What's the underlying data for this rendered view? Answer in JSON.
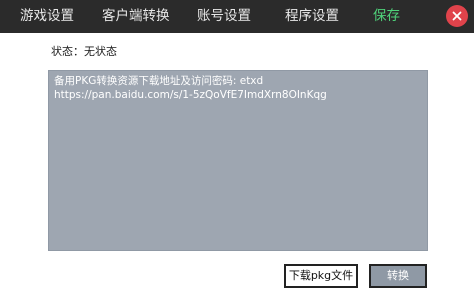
{
  "nav": {
    "tabs": [
      {
        "label": "游戏设置"
      },
      {
        "label": "客户端转换"
      },
      {
        "label": "账号设置"
      },
      {
        "label": "程序设置"
      }
    ],
    "save_label": "保存",
    "close_icon": "close-icon"
  },
  "status": {
    "text": "状态：无状态"
  },
  "log": {
    "text": "备用PKG转换资源下载地址及访问密码: etxd\nhttps://pan.baidu.com/s/1-5zQoVfE7ImdXrn8OInKqg"
  },
  "actions": {
    "download_label": "下载pkg文件",
    "convert_label": "转换"
  },
  "colors": {
    "topbar": "#2b2b2b",
    "save": "#4fd27a",
    "close": "#e0434b",
    "textarea_bg": "#9ea6b1",
    "convert_bg": "#8f99a5"
  }
}
